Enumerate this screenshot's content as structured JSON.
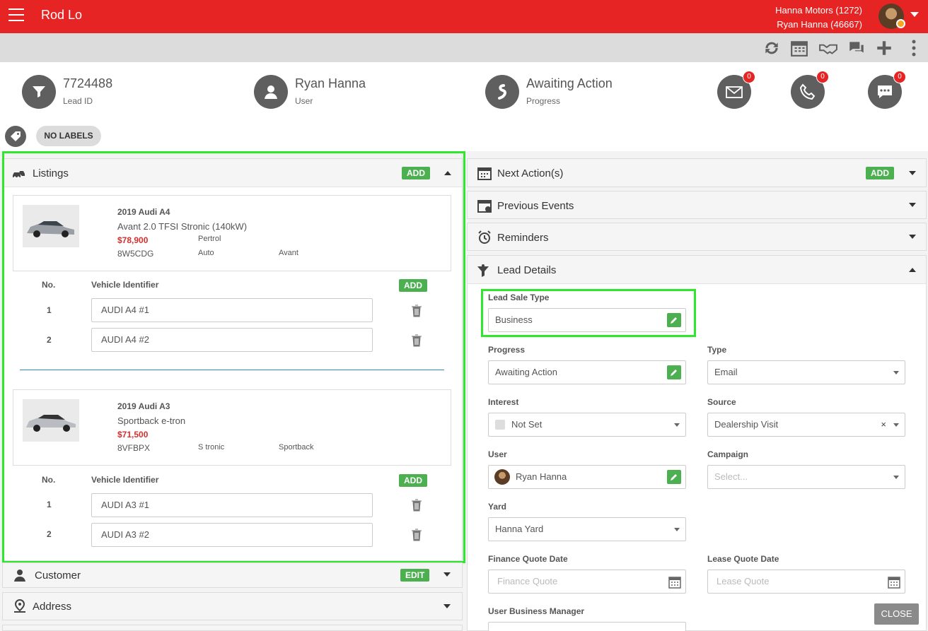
{
  "topbar": {
    "title": "Rod Lo",
    "dealer": "Hanna Motors (1272)",
    "user": "Ryan Hanna (46667)"
  },
  "summary": {
    "lead_id": "7724488",
    "lead_id_label": "Lead ID",
    "user": "Ryan Hanna",
    "user_label": "User",
    "progress": "Awaiting Action",
    "progress_label": "Progress",
    "email_count": "0",
    "call_count": "0",
    "sms_count": "0"
  },
  "labels": {
    "no_labels": "NO LABELS"
  },
  "listings": {
    "title": "Listings",
    "add": "ADD",
    "col_no": "No.",
    "col_vid": "Vehicle Identifier",
    "col_add": "ADD",
    "vehicles": [
      {
        "title": "2019 Audi A4",
        "variant": "Avant 2.0 TFSI Stronic (140kW)",
        "price": "$78,900",
        "fuel": "Pertrol",
        "stock": "8W5CDG",
        "trans": "Auto",
        "body": "Avant",
        "ids": [
          {
            "no": "1",
            "value": "AUDI A4 #1"
          },
          {
            "no": "2",
            "value": "AUDI A4 #2"
          }
        ]
      },
      {
        "title": "2019 Audi A3",
        "variant": "Sportback e-tron",
        "price": "$71,500",
        "fuel": "",
        "stock": "8VFBPX",
        "trans": "S tronic",
        "body": "Sportback",
        "ids": [
          {
            "no": "1",
            "value": "AUDI A3 #1"
          },
          {
            "no": "2",
            "value": "AUDI A3 #2"
          }
        ]
      }
    ]
  },
  "customer": {
    "title": "Customer",
    "edit": "EDIT"
  },
  "address": {
    "title": "Address"
  },
  "next_actions": {
    "title": "Next Action(s)",
    "add": "ADD"
  },
  "previous_events": {
    "title": "Previous Events"
  },
  "reminders": {
    "title": "Reminders"
  },
  "lead_details": {
    "title": "Lead Details",
    "sale_type_label": "Lead Sale Type",
    "sale_type": "Business",
    "progress_label": "Progress",
    "progress": "Awaiting Action",
    "type_label": "Type",
    "type": "Email",
    "interest_label": "Interest",
    "interest": "Not Set",
    "source_label": "Source",
    "source": "Dealership Visit",
    "user_label": "User",
    "user": "Ryan Hanna",
    "campaign_label": "Campaign",
    "campaign_placeholder": "Select...",
    "yard_label": "Yard",
    "yard": "Hanna Yard",
    "finance_label": "Finance Quote Date",
    "finance_placeholder": "Finance Quote",
    "lease_label": "Lease Quote Date",
    "lease_placeholder": "Lease Quote",
    "business_manager_label": "User Business Manager",
    "close": "CLOSE"
  },
  "colors": {
    "brand": "#e62424",
    "accent": "#4caf50",
    "highlight": "#2ee82e",
    "price": "#d32f2f"
  }
}
